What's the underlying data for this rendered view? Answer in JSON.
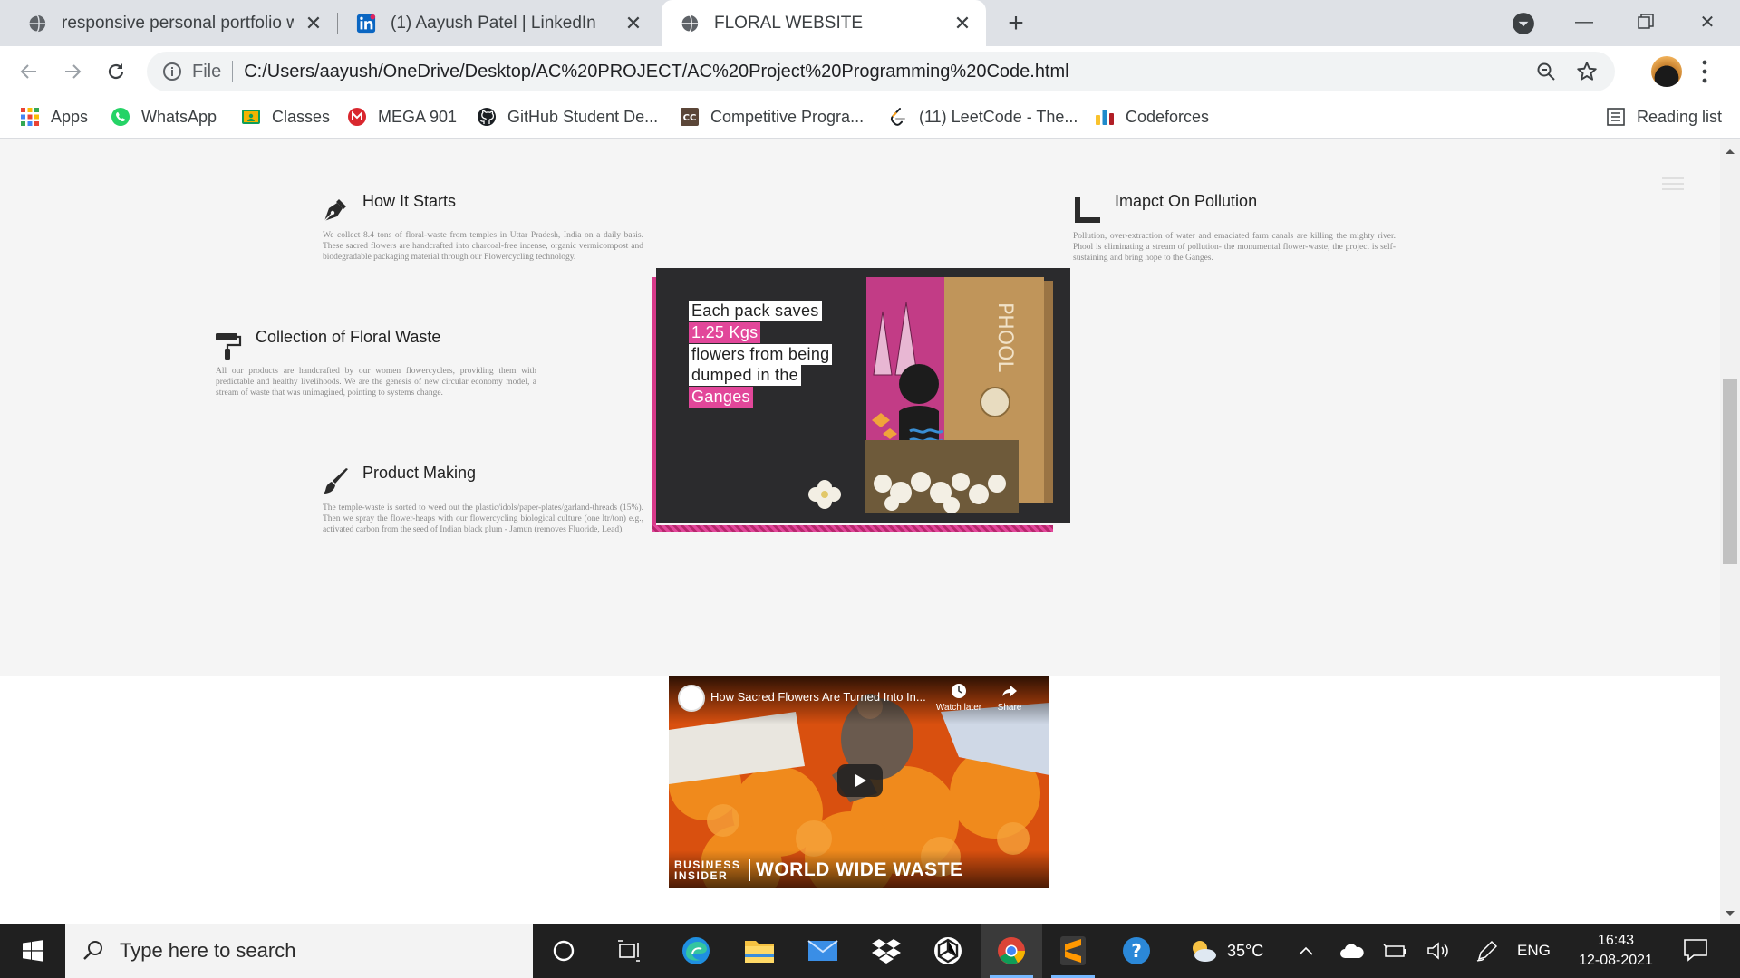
{
  "tabs": [
    {
      "title": "responsive personal portfolio web",
      "icon": "globe-icon"
    },
    {
      "title": "(1) Aayush Patel | LinkedIn",
      "icon": "linkedin-icon"
    },
    {
      "title": "FLORAL WEBSITE",
      "icon": "globe-icon",
      "active": true
    }
  ],
  "address_bar": {
    "scheme_label": "File",
    "url": "C:/Users/aayush/OneDrive/Desktop/AC%20PROJECT/AC%20Project%20Programming%20Code.html"
  },
  "bookmarks": [
    {
      "label": "Apps",
      "icon": "apps-grid-icon"
    },
    {
      "label": "WhatsApp",
      "icon": "whatsapp-icon"
    },
    {
      "label": "Classes",
      "icon": "classroom-icon"
    },
    {
      "label": "MEGA 901",
      "icon": "mega-icon"
    },
    {
      "label": "GitHub Student De...",
      "icon": "github-icon"
    },
    {
      "label": "Competitive Progra...",
      "icon": "codechef-icon"
    },
    {
      "label": "(11) LeetCode - The...",
      "icon": "leetcode-icon"
    },
    {
      "label": "Codeforces",
      "icon": "codeforces-icon"
    }
  ],
  "reading_list": "Reading list",
  "features": {
    "how_it_starts": {
      "title": "How It Starts",
      "text": "We collect 8.4 tons of floral-waste from temples in Uttar Pradesh, India on a daily basis. These sacred flowers are handcrafted into charcoal-free incense, organic vermicompost and biodegradable packaging material through our Flowercycling technology."
    },
    "collection": {
      "title": "Collection of Floral Waste",
      "text": "All our products are handcrafted by our women flowercyclers, providing them with predictable and healthy livelihoods. We are the genesis of new circular economy model, a stream of waste that was unimagined, pointing to systems change."
    },
    "product_making": {
      "title": "Product Making",
      "text": "The temple-waste is sorted to weed out the plastic/idols/paper-plates/garland-threads (15%). Then we spray the flower-heaps with our flowercycling biological culture (one ltr/ton) e.g., activated carbon from the seed of Indian black plum - Jamun (removes Fluoride, Lead)."
    },
    "pollution": {
      "title": "Imapct On Pollution",
      "text": "Pollution, over-extraction of water and emaciated farm canals are killing the mighty river. Phool is eliminating a stream of pollution- the monumental flower-waste, the project is self-sustaining and bring hope to the Ganges."
    }
  },
  "product_image": {
    "lines": [
      "Each pack saves",
      "1.25 Kgs",
      "flowers from being",
      "dumped in the",
      "Ganges"
    ],
    "box_brand": "PHOOL"
  },
  "video": {
    "title": "How Sacred Flowers Are Turned Into In...",
    "watch_later": "Watch later",
    "share": "Share",
    "brand_top": "BUSINESS",
    "brand_bottom": "INSIDER",
    "series": "WORLD WIDE WASTE"
  },
  "taskbar": {
    "search_placeholder": "Type here to search",
    "temperature": "35°C",
    "language": "ENG",
    "time": "16:43",
    "date": "12-08-2021"
  },
  "colors": {
    "accent_pink": "#e2479a",
    "chrome_tabstrip": "#dee1e6",
    "taskbar": "#202020"
  }
}
